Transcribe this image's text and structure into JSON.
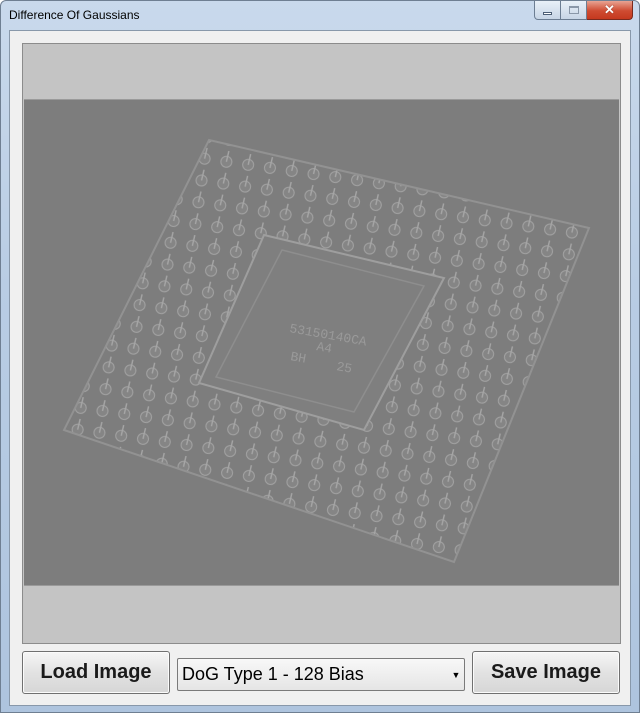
{
  "window": {
    "title": "Difference Of Gaussians",
    "min_icon": "minimize-icon",
    "max_icon": "maximize-icon",
    "close_icon": "close-icon",
    "close_glyph": "✕"
  },
  "picture": {
    "chip_line1": "53150140CA",
    "chip_line2": "A4",
    "chip_line3": "BH",
    "chip_line4": "25"
  },
  "controls": {
    "load_label": "Load Image",
    "save_label": "Save Image",
    "filter_selected": "DoG Type 1 - 128 Bias",
    "arrow_glyph": "▼"
  }
}
